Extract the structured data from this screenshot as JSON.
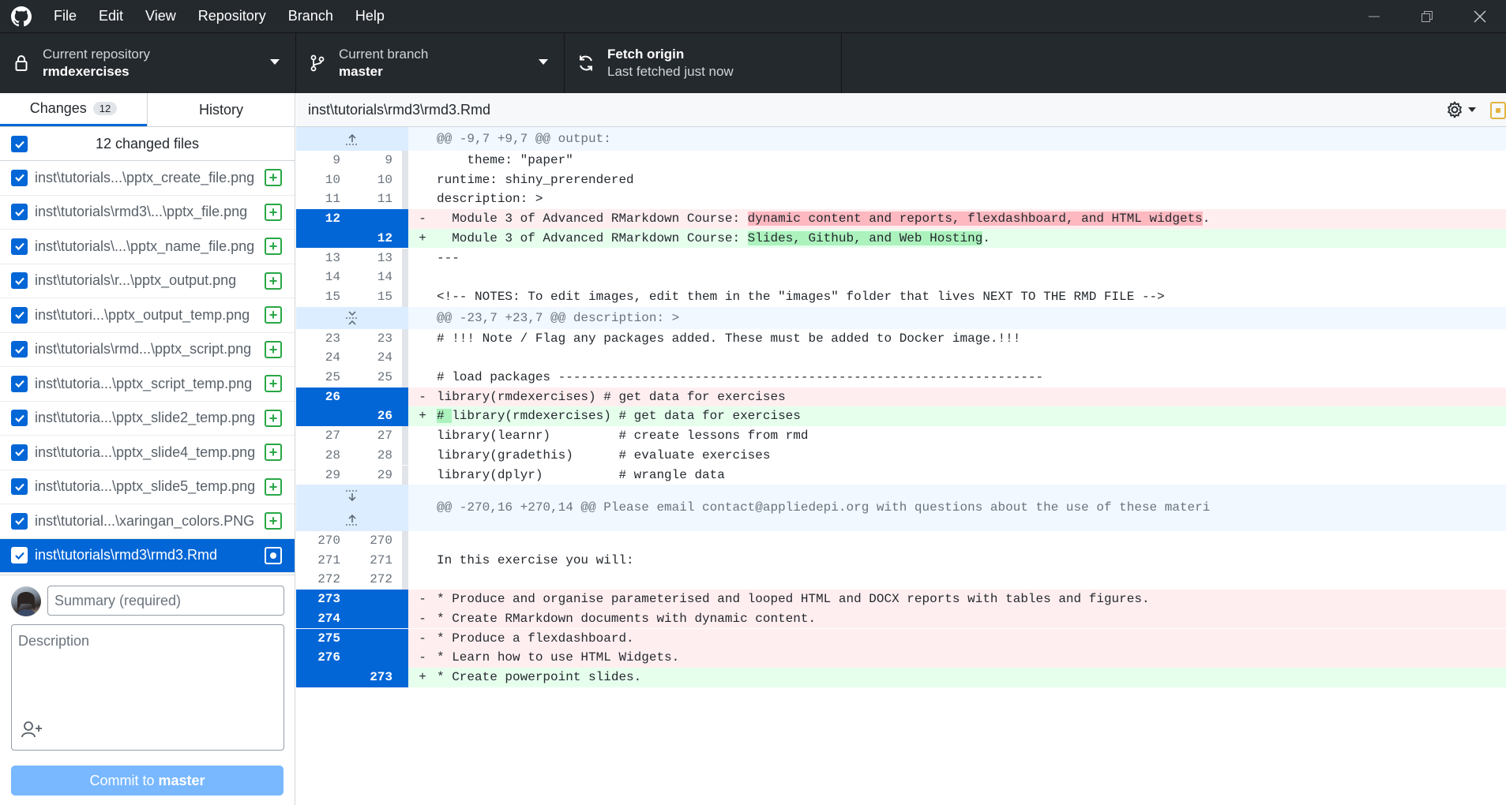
{
  "menu": [
    "File",
    "Edit",
    "View",
    "Repository",
    "Branch",
    "Help"
  ],
  "toolbar": {
    "repo_label": "Current repository",
    "repo_value": "rmdexercises",
    "branch_label": "Current branch",
    "branch_value": "master",
    "fetch_label": "Fetch origin",
    "fetch_sub": "Last fetched just now"
  },
  "sidebar": {
    "tab_changes": "Changes",
    "tab_changes_count": "12",
    "tab_history": "History",
    "changed_files_label": "12 changed files",
    "files": [
      {
        "name": "inst\\tutorials...\\pptx_create_file.png",
        "status": "+"
      },
      {
        "name": "inst\\tutorials\\rmd3\\...\\pptx_file.png",
        "status": "+"
      },
      {
        "name": "inst\\tutorials\\...\\pptx_name_file.png",
        "status": "+"
      },
      {
        "name": "inst\\tutorials\\r...\\pptx_output.png",
        "status": "+"
      },
      {
        "name": "inst\\tutori...\\pptx_output_temp.png",
        "status": "+"
      },
      {
        "name": "inst\\tutorials\\rmd...\\pptx_script.png",
        "status": "+"
      },
      {
        "name": "inst\\tutoria...\\pptx_script_temp.png",
        "status": "+"
      },
      {
        "name": "inst\\tutoria...\\pptx_slide2_temp.png",
        "status": "+"
      },
      {
        "name": "inst\\tutoria...\\pptx_slide4_temp.png",
        "status": "+"
      },
      {
        "name": "inst\\tutoria...\\pptx_slide5_temp.png",
        "status": "+"
      },
      {
        "name": "inst\\tutorial...\\xaringan_colors.PNG",
        "status": "+"
      },
      {
        "name": "inst\\tutorials\\rmd3\\rmd3.Rmd",
        "status": "modified"
      }
    ],
    "summary_placeholder": "Summary (required)",
    "description_placeholder": "Description",
    "commit_prefix": "Commit to",
    "commit_branch": "master"
  },
  "diff": {
    "path": "inst\\tutorials\\rmd3\\rmd3.Rmd",
    "lines": [
      {
        "type": "hunk",
        "old": "",
        "new": "",
        "sign": "",
        "code": "@@ -9,7 +9,7 @@ output:",
        "expander": "up"
      },
      {
        "type": "ctx",
        "old": "9",
        "new": "9",
        "sign": "",
        "code": "    theme: \"paper\""
      },
      {
        "type": "ctx",
        "old": "10",
        "new": "10",
        "sign": "",
        "code": "runtime: shiny_prerendered"
      },
      {
        "type": "ctx",
        "old": "11",
        "new": "11",
        "sign": "",
        "code": "description: >"
      },
      {
        "type": "del",
        "old": "12",
        "new": "",
        "sign": "-",
        "code_pre": "  Module 3 of Advanced RMarkdown Course: ",
        "code_hl": "dynamic content and reports, flexdashboard, and HTML widgets",
        "code_post": "."
      },
      {
        "type": "add",
        "old": "",
        "new": "12",
        "sign": "+",
        "code_pre": "  Module 3 of Advanced RMarkdown Course: ",
        "code_hl": "Slides, Github, and Web Hosting",
        "code_post": "."
      },
      {
        "type": "ctx",
        "old": "13",
        "new": "13",
        "sign": "",
        "code": "---"
      },
      {
        "type": "ctx",
        "old": "14",
        "new": "14",
        "sign": "",
        "code": ""
      },
      {
        "type": "ctx",
        "old": "15",
        "new": "15",
        "sign": "",
        "code": "<!-- NOTES: To edit images, edit them in the \"images\" folder that lives NEXT TO THE RMD FILE -->"
      },
      {
        "type": "hunk",
        "old": "",
        "new": "",
        "sign": "",
        "code": "@@ -23,7 +23,7 @@ description: >",
        "expander": "both"
      },
      {
        "type": "ctx",
        "old": "23",
        "new": "23",
        "sign": "",
        "code": "# !!! Note / Flag any packages added. These must be added to Docker image.!!!"
      },
      {
        "type": "ctx",
        "old": "24",
        "new": "24",
        "sign": "",
        "code": ""
      },
      {
        "type": "ctx",
        "old": "25",
        "new": "25",
        "sign": "",
        "code": "# load packages ----------------------------------------------------------------"
      },
      {
        "type": "del",
        "old": "26",
        "new": "",
        "sign": "-",
        "code_pre": "",
        "code_hl": "",
        "code_post": "library(rmdexercises) # get data for exercises"
      },
      {
        "type": "add",
        "old": "",
        "new": "26",
        "sign": "+",
        "code_pre": "",
        "code_hl": "# ",
        "code_post": "library(rmdexercises) # get data for exercises"
      },
      {
        "type": "ctx",
        "old": "27",
        "new": "27",
        "sign": "",
        "code": "library(learnr)         # create lessons from rmd"
      },
      {
        "type": "ctx",
        "old": "28",
        "new": "28",
        "sign": "",
        "code": "library(gradethis)      # evaluate exercises"
      },
      {
        "type": "ctx",
        "old": "29",
        "new": "29",
        "sign": "",
        "code": "library(dplyr)          # wrangle data"
      },
      {
        "type": "hunk2",
        "old": "",
        "new": "",
        "sign": "",
        "code": "@@ -270,16 +270,14 @@ Please email contact@appliedepi.org with questions about the use of these materi",
        "expander": "split"
      },
      {
        "type": "ctx",
        "old": "270",
        "new": "270",
        "sign": "",
        "code": ""
      },
      {
        "type": "ctx",
        "old": "271",
        "new": "271",
        "sign": "",
        "code": "In this exercise you will:"
      },
      {
        "type": "ctx",
        "old": "272",
        "new": "272",
        "sign": "",
        "code": ""
      },
      {
        "type": "del",
        "old": "273",
        "new": "",
        "sign": "-",
        "code_pre": "",
        "code_hl": "",
        "code_post": "* Produce and organise parameterised and looped HTML and DOCX reports with tables and figures."
      },
      {
        "type": "del",
        "old": "274",
        "new": "",
        "sign": "-",
        "code_pre": "",
        "code_hl": "",
        "code_post": "* Create RMarkdown documents with dynamic content."
      },
      {
        "type": "del",
        "old": "275",
        "new": "",
        "sign": "-",
        "code_pre": "",
        "code_hl": "",
        "code_post": "* Produce a flexdashboard."
      },
      {
        "type": "del",
        "old": "276",
        "new": "",
        "sign": "-",
        "code_pre": "",
        "code_hl": "",
        "code_post": "* Learn how to use HTML Widgets."
      },
      {
        "type": "add",
        "old": "",
        "new": "273",
        "sign": "+",
        "code_pre": "",
        "code_hl": "",
        "code_post": "* Create powerpoint slides."
      }
    ]
  },
  "colors": {
    "titlebar": "#24292e",
    "accent": "#0366d6",
    "added": "#28a745",
    "del_bg": "#ffeef0",
    "add_bg": "#e6ffed"
  }
}
